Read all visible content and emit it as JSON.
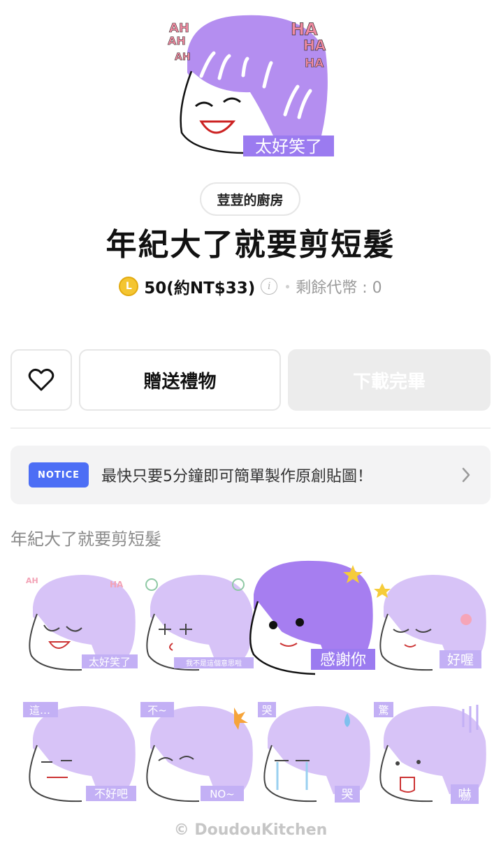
{
  "hero": {
    "caption": "太好笑了",
    "left_text": [
      "AH",
      "AH",
      "AH"
    ],
    "right_text": [
      "HA",
      "HA",
      "HA"
    ]
  },
  "author": "荳荳的廚房",
  "title": "年紀大了就要剪短髮",
  "price": {
    "coin_symbol": "L",
    "label": "50(約NT$33)",
    "info": "i",
    "coins_left": "剩餘代幣 : 0"
  },
  "buttons": {
    "gift": "贈送禮物",
    "download": "下載完畢"
  },
  "notice": {
    "badge": "NOTICE",
    "text": "最快只要5分鐘即可簡單製作原創貼圖！"
  },
  "section_label": "年紀大了就要剪短髮",
  "stickers": [
    {
      "caption": "太好笑了",
      "top_text": "AH HA"
    },
    {
      "caption": "我不是這個意思啦",
      "top_text": ""
    },
    {
      "caption": "感謝你",
      "top_text": ""
    },
    {
      "caption": "好喔",
      "top_text": ""
    },
    {
      "caption": "不好吧",
      "top_text": "這…"
    },
    {
      "caption": "NO~",
      "top_text": "不~"
    },
    {
      "caption": "哭",
      "top_text": "哭"
    },
    {
      "caption": "嚇",
      "top_text": "驚"
    }
  ],
  "footer": "© DoudouKitchen",
  "colors": {
    "accent": "#4c6ef5",
    "hair": "#b48ef0",
    "coin": "#f4c531"
  }
}
